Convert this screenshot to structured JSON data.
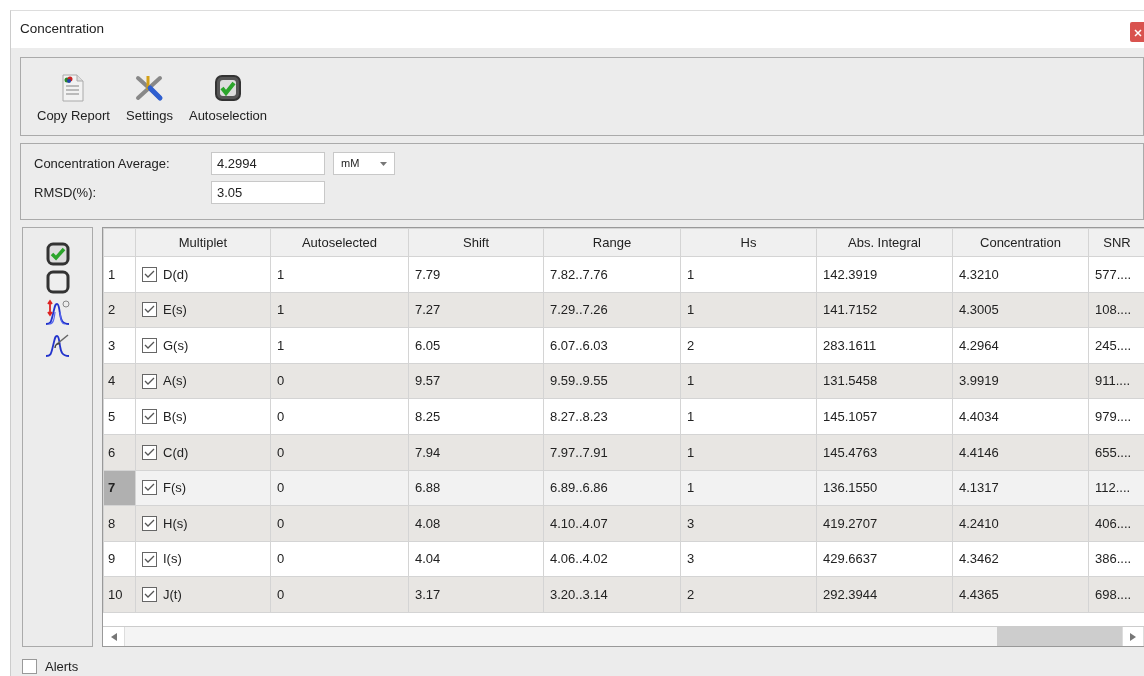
{
  "window": {
    "title": "Concentration"
  },
  "toolbar": [
    {
      "label": "Copy Report",
      "kind": "report"
    },
    {
      "label": "Settings",
      "kind": "settings"
    },
    {
      "label": "Autoselection",
      "kind": "auto"
    }
  ],
  "fields": {
    "average_label": "Concentration Average:",
    "average_value": "4.2994",
    "unit": "mM",
    "rmsd_label": "RMSD(%):",
    "rmsd_value": "3.05"
  },
  "table": {
    "columns": [
      "Multiplet",
      "Autoselected",
      "Shift",
      "Range",
      "Hs",
      "Abs. Integral",
      "Concentration",
      "SNR"
    ],
    "rows": [
      {
        "number": "1",
        "checked": true,
        "selected": false,
        "cells": [
          "D(d)",
          "1",
          "7.79",
          "7.82..7.76",
          "1",
          "142.3919",
          "4.3210",
          "577...."
        ]
      },
      {
        "number": "2",
        "checked": true,
        "selected": false,
        "cells": [
          "E(s)",
          "1",
          "7.27",
          "7.29..7.26",
          "1",
          "141.7152",
          "4.3005",
          "108...."
        ]
      },
      {
        "number": "3",
        "checked": true,
        "selected": false,
        "cells": [
          "G(s)",
          "1",
          "6.05",
          "6.07..6.03",
          "2",
          "283.1611",
          "4.2964",
          "245...."
        ]
      },
      {
        "number": "4",
        "checked": true,
        "selected": false,
        "cells": [
          "A(s)",
          "0",
          "9.57",
          "9.59..9.55",
          "1",
          "131.5458",
          "3.9919",
          "911...."
        ]
      },
      {
        "number": "5",
        "checked": true,
        "selected": false,
        "cells": [
          "B(s)",
          "0",
          "8.25",
          "8.27..8.23",
          "1",
          "145.1057",
          "4.4034",
          "979...."
        ]
      },
      {
        "number": "6",
        "checked": true,
        "selected": false,
        "cells": [
          "C(d)",
          "0",
          "7.94",
          "7.97..7.91",
          "1",
          "145.4763",
          "4.4146",
          "655...."
        ]
      },
      {
        "number": "7",
        "checked": true,
        "selected": true,
        "cells": [
          "F(s)",
          "0",
          "6.88",
          "6.89..6.86",
          "1",
          "136.1550",
          "4.1317",
          "112...."
        ]
      },
      {
        "number": "8",
        "checked": true,
        "selected": false,
        "cells": [
          "H(s)",
          "0",
          "4.08",
          "4.10..4.07",
          "3",
          "419.2707",
          "4.2410",
          "406...."
        ]
      },
      {
        "number": "9",
        "checked": true,
        "selected": false,
        "cells": [
          "I(s)",
          "0",
          "4.04",
          "4.06..4.02",
          "3",
          "429.6637",
          "4.3462",
          "386...."
        ]
      },
      {
        "number": "10",
        "checked": true,
        "selected": false,
        "cells": [
          "J(t)",
          "0",
          "3.17",
          "3.20..3.14",
          "2",
          "292.3944",
          "4.4365",
          "698...."
        ]
      }
    ]
  },
  "alerts": {
    "label": "Alerts",
    "checked": false
  }
}
